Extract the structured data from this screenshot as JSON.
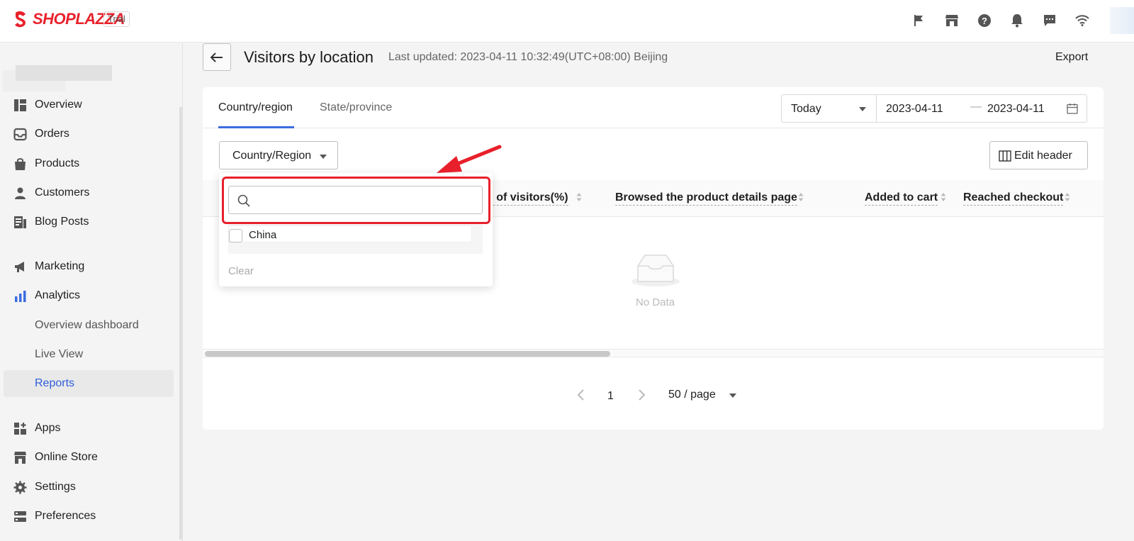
{
  "app": {
    "brand": "SHOPLAZZA",
    "trial_badge": "Trial",
    "brand_color": "#e8222c",
    "accent_color": "#3b6de0"
  },
  "topbar": {
    "icons": [
      "flag-icon",
      "store-icon",
      "help-icon",
      "bell-icon",
      "chat-icon",
      "wifi-icon"
    ]
  },
  "sidebar": {
    "items": [
      {
        "label": "Overview",
        "icon": "overview-icon"
      },
      {
        "label": "Orders",
        "icon": "orders-icon"
      },
      {
        "label": "Products",
        "icon": "products-icon"
      },
      {
        "label": "Customers",
        "icon": "customers-icon"
      },
      {
        "label": "Blog Posts",
        "icon": "blog-icon"
      },
      {
        "label": "Marketing",
        "icon": "megaphone-icon"
      },
      {
        "label": "Analytics",
        "icon": "analytics-icon"
      },
      {
        "label": "Overview dashboard"
      },
      {
        "label": "Live View"
      },
      {
        "label": "Reports",
        "active": true
      },
      {
        "label": "Apps",
        "icon": "apps-icon"
      },
      {
        "label": "Online Store",
        "icon": "online-store-icon"
      },
      {
        "label": "Settings",
        "icon": "settings-icon"
      },
      {
        "label": "Preferences",
        "icon": "preferences-icon"
      }
    ]
  },
  "header": {
    "title": "Visitors by location",
    "last_updated": "Last updated: 2023-04-11 10:32:49(UTC+08:00) Beijing",
    "export_label": "Export"
  },
  "tabs": [
    "Country/region",
    "State/province"
  ],
  "date_range": {
    "preset": "Today",
    "start": "2023-04-11",
    "separator": "—",
    "end": "2023-04-11"
  },
  "filters": {
    "country_label": "Country/Region",
    "edit_header_label": "Edit header"
  },
  "table": {
    "columns": [
      "n of visitors(%)",
      "Browsed the product details page",
      "Added to cart",
      "Reached checkout"
    ],
    "empty_text": "No Data"
  },
  "pagination": {
    "page": "1",
    "page_size": "50 / page"
  },
  "dropdown": {
    "search_value": "",
    "options": [
      "China"
    ],
    "clear_label": "Clear"
  }
}
